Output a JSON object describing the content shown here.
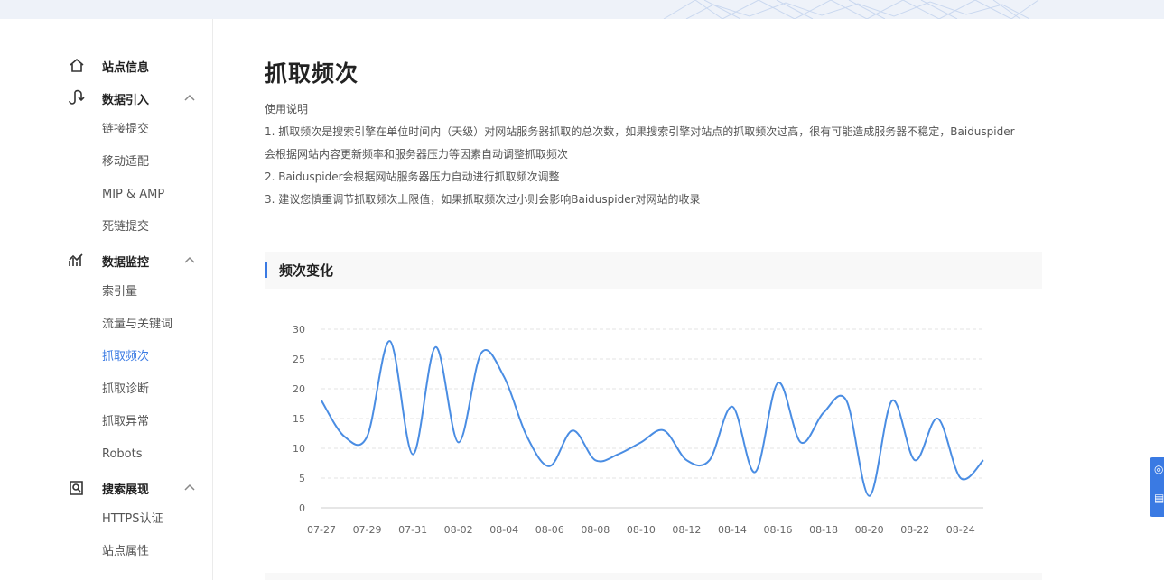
{
  "page": {
    "title": "抓取频次"
  },
  "sidebar": {
    "groups": [
      {
        "label": "站点信息",
        "icon": "home-icon",
        "expandable": false,
        "items": []
      },
      {
        "label": "数据引入",
        "icon": "data-import-icon",
        "expandable": true,
        "items": [
          "链接提交",
          "移动适配",
          "MIP & AMP",
          "死链提交"
        ]
      },
      {
        "label": "数据监控",
        "icon": "data-monitor-icon",
        "expandable": true,
        "items": [
          "索引量",
          "流量与关键词",
          "抓取频次",
          "抓取诊断",
          "抓取异常",
          "Robots"
        ]
      },
      {
        "label": "搜索展现",
        "icon": "search-display-icon",
        "expandable": true,
        "items": [
          "HTTPS认证",
          "站点属性"
        ]
      }
    ],
    "active_item": "抓取频次",
    "accent_color": "#3a7ae3"
  },
  "description": {
    "heading": "使用说明",
    "lines": [
      "1. 抓取频次是搜索引擎在单位时间内（天级）对网站服务器抓取的总次数，如果搜索引擎对站点的抓取频次过高，很有可能造成服务器不稳定，Baiduspider",
      "会根据网站内容更新频率和服务器压力等因素自动调整抓取频次",
      "2. Baiduspider会根据网站服务器压力自动进行抓取频次调整",
      "3. 建议您慎重调节抓取频次上限值，如果抓取频次过小则会影响Baiduspider对网站的收录"
    ]
  },
  "section": {
    "title": "频次变化"
  },
  "chart_data": {
    "type": "line",
    "title": "",
    "xlabel": "",
    "ylabel": "",
    "ylim": [
      0,
      30
    ],
    "yticks": [
      0,
      5,
      10,
      15,
      20,
      25,
      30
    ],
    "grid": "horizontal-dashed",
    "line_color": "#4a8de3",
    "x": [
      "07-27",
      "07-28",
      "07-29",
      "07-30",
      "07-31",
      "08-01",
      "08-02",
      "08-03",
      "08-04",
      "08-05",
      "08-06",
      "08-07",
      "08-08",
      "08-09",
      "08-10",
      "08-11",
      "08-12",
      "08-13",
      "08-14",
      "08-15",
      "08-16",
      "08-17",
      "08-18",
      "08-19",
      "08-20",
      "08-21",
      "08-22",
      "08-23",
      "08-24",
      "08-25"
    ],
    "xticks": [
      "07-27",
      "07-29",
      "07-31",
      "08-02",
      "08-04",
      "08-06",
      "08-08",
      "08-10",
      "08-12",
      "08-14",
      "08-16",
      "08-18",
      "08-20",
      "08-22",
      "08-24"
    ],
    "series": [
      {
        "values": [
          18,
          12,
          12,
          28,
          9,
          27,
          11,
          26,
          22,
          12,
          7,
          13,
          8,
          9,
          11,
          13,
          8,
          8,
          17,
          6,
          21,
          11,
          16,
          18,
          2,
          18,
          8,
          15,
          5,
          8
        ]
      }
    ]
  }
}
